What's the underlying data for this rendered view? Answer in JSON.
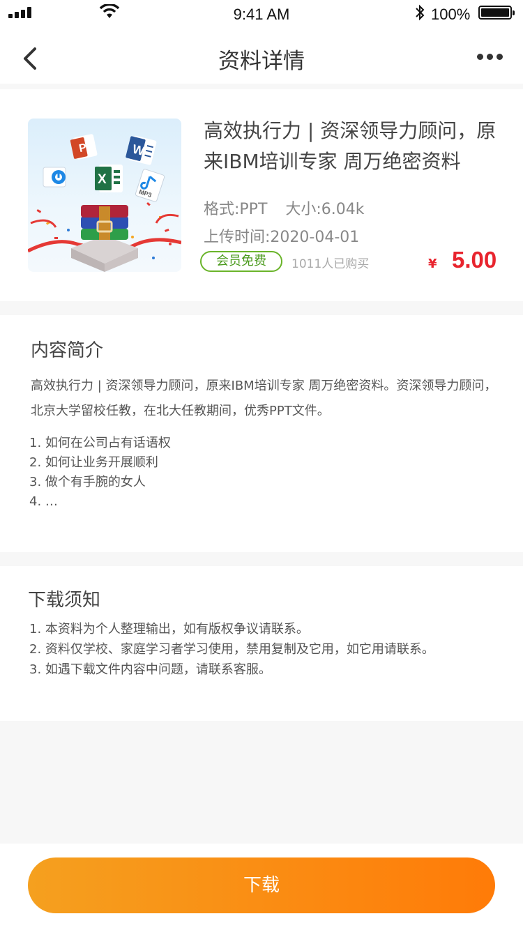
{
  "status_bar": {
    "time": "9:41 AM",
    "battery": "100%"
  },
  "nav": {
    "title": "资料详情",
    "back_icon": "chevron-left-icon",
    "more_icon": "more-icon"
  },
  "product": {
    "title": "高效执行力 | 资深领导力顾问，原来IBM培训专家 周万绝密资料",
    "format": "格式:PPT",
    "size": "大小:6.04k",
    "upload_time": "上传时间:2020-04-01",
    "badge": "会员免费",
    "buyers": "1011人已购买",
    "price_symbol": "¥",
    "price": "5.00",
    "thumbnail_icons": {
      "powerpoint": "P",
      "word": "W",
      "excel": "X",
      "mp3": "MP3"
    }
  },
  "intro": {
    "heading": "内容简介",
    "text": "高效执行力 | 资深领导力顾问，原来IBM培训专家 周万绝密资料。资深领导力顾问，北京大学留校任教，在北大任教期间，优秀PPT文件。",
    "items": [
      "1. 如何在公司占有话语权",
      "2. 如何让业务开展顺利",
      "3. 做个有手腕的女人",
      "4. …"
    ]
  },
  "notice": {
    "heading": "下载须知",
    "items": [
      "1. 本资料为个人整理输出，如有版权争议请联系。",
      "2. 资料仅学校、家庭学习者学习使用，禁用复制及它用，如它用请联系。",
      "3. 如遇下载文件内容中问题，请联系客服。"
    ]
  },
  "download_button": "下载",
  "colors": {
    "accent_orange": "#ff7b08",
    "price_red": "#e8242e",
    "badge_green": "#6ab42a"
  }
}
